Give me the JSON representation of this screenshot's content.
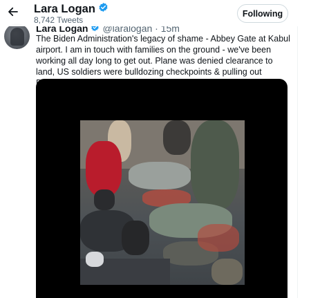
{
  "header": {
    "name": "Lara Logan",
    "tweet_count": "8,742 Tweets",
    "follow_label": "Following"
  },
  "tweet": {
    "author_name": "Lara Logan",
    "author_handle": "@laralogan · 15m",
    "text": "The Biden Administration's legacy of shame - Abbey Gate at Kabul airport. I am in touch with families on the ground - we've been working all day long to get out. Plane was denied clearance to land, US soldiers were bulldozing checkpoints & pulling out BEFORE this happened."
  },
  "icons": {
    "back": "arrow-left-icon",
    "verified": "verified-badge-icon"
  },
  "colors": {
    "verified": "#1d9bf0",
    "text": "#0f1419",
    "muted": "#536471"
  }
}
